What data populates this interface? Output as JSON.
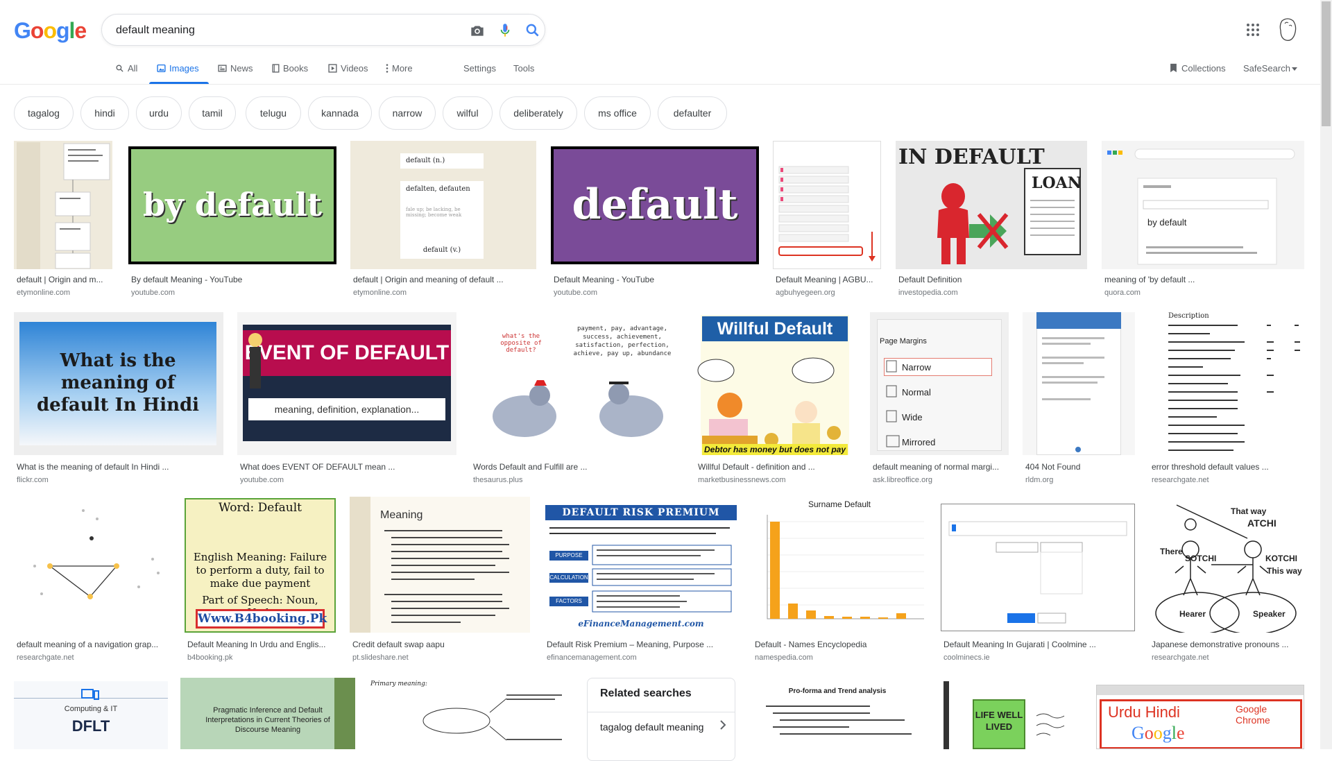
{
  "logo": {
    "letters": [
      "G",
      "o",
      "o",
      "g",
      "l",
      "e"
    ],
    "colors": [
      "#4285f4",
      "#ea4335",
      "#fbbc05",
      "#4285f4",
      "#34a853",
      "#ea4335"
    ]
  },
  "search": {
    "value": "default meaning"
  },
  "tabs": [
    {
      "label": "All",
      "icon": "search-icon"
    },
    {
      "label": "Images",
      "icon": "image-icon"
    },
    {
      "label": "News",
      "icon": "news-icon"
    },
    {
      "label": "Books",
      "icon": "book-icon"
    },
    {
      "label": "Videos",
      "icon": "play-icon"
    },
    {
      "label": "More",
      "icon": "more-vert-icon"
    }
  ],
  "settings_label": "Settings",
  "tools_label": "Tools",
  "collections_label": "Collections",
  "safesearch_label": "SafeSearch",
  "chips": [
    "tagalog",
    "hindi",
    "urdu",
    "tamil",
    "telugu",
    "kannada",
    "narrow",
    "wilful",
    "deliberately",
    "ms office",
    "defaulter"
  ],
  "results": [
    {
      "title": "default | Origin and m...",
      "source": "etymonline.com"
    },
    {
      "title": "By default Meaning - YouTube",
      "source": "youtube.com",
      "thumb_text": "by default"
    },
    {
      "title": "default | Origin and meaning of default ...",
      "source": "etymonline.com",
      "thumb_lines": [
        "default (n.)",
        "defalten, defauten",
        "fale up; be lacking, be missing; become weak",
        "default (v.)"
      ]
    },
    {
      "title": "Default Meaning - YouTube",
      "source": "youtube.com",
      "thumb_text": "default"
    },
    {
      "title": "Default Meaning | AGBU...",
      "source": "agbuhyegeen.org"
    },
    {
      "title": "Default Definition",
      "source": "investopedia.com",
      "thumb_text": "IN DEFAULT",
      "thumb_sub": "LOAN"
    },
    {
      "title": "meaning of 'by default ...",
      "source": "quora.com",
      "thumb_text": "by default"
    },
    {
      "title": "What is the meaning of default In Hindi ...",
      "source": "flickr.com",
      "thumb_text": "What is the meaning of default In Hindi"
    },
    {
      "title": "What does EVENT OF DEFAULT mean ...",
      "source": "youtube.com",
      "thumb_text": "EVENT OF DEFAULT",
      "thumb_sub": "meaning, definition, explanation..."
    },
    {
      "title": "Words Default and Fulfill are ...",
      "source": "thesaurus.plus",
      "thumb_text": "what's the opposite of default?",
      "thumb_sub": "payment, pay, advantage, success, achievement, satisfaction, perfection, achieve, pay up, abundance"
    },
    {
      "title": "Willful Default - definition and ...",
      "source": "marketbusinessnews.com",
      "thumb_text": "Willful Default",
      "thumb_sub": "Debtor has money but does not pay"
    },
    {
      "title": "default meaning of normal margi...",
      "source": "ask.libreoffice.org",
      "thumb_text": "Page Margins",
      "thumb_items": [
        "Narrow",
        "Normal",
        "Wide",
        "Mirrored"
      ]
    },
    {
      "title": "404 Not Found",
      "source": "rldm.org"
    },
    {
      "title": "error threshold default values ...",
      "source": "researchgate.net",
      "thumb_text": "Description"
    },
    {
      "title": "default meaning of a navigation grap...",
      "source": "researchgate.net"
    },
    {
      "title": "Default Meaning In Urdu and Englis...",
      "source": "b4booking.pk",
      "thumb_lines": [
        "Word: Default",
        "English Meaning: Failure to perform a duty, fail to make due payment",
        "Part of Speech: Noun, Verb",
        "Www.B4booking.Pk"
      ]
    },
    {
      "title": "Credit default swap aapu",
      "source": "pt.slideshare.net",
      "thumb_text": "Meaning"
    },
    {
      "title": "Default Risk Premium – Meaning, Purpose ...",
      "source": "efinancemanagement.com",
      "thumb_text": "DEFAULT RISK PREMIUM",
      "thumb_sub": "eFinanceManagement.com",
      "thumb_items": [
        "PURPOSE",
        "CALCULATION",
        "FACTORS"
      ]
    },
    {
      "title": "Default - Names Encyclopedia",
      "source": "namespedia.com",
      "thumb_text": "Surname Default"
    },
    {
      "title": "Default Meaning In Gujarati | Coolmine ...",
      "source": "coolminecs.ie"
    },
    {
      "title": "Japanese demonstrative pronouns ...",
      "source": "researchgate.net",
      "thumb_items": [
        "That way",
        "ATCHI",
        "There",
        "SOTCHI",
        "KOTCHI",
        "This way",
        "Hearer",
        "Speaker"
      ]
    },
    {
      "title": "",
      "source": "",
      "thumb_text": "DFLT",
      "thumb_sub": "Computing & IT"
    },
    {
      "title": "",
      "source": "",
      "thumb_text": "Pragmatic Inference and Default Interpretations in Current Theories of Discourse Meaning"
    },
    {
      "title": "",
      "source": "",
      "thumb_text": "Primary meaning:"
    },
    {
      "title": "",
      "source": "",
      "thumb_text": "Pro-forma and Trend analysis"
    },
    {
      "title": "",
      "source": "",
      "thumb_text": "LIFE WELL LIVED"
    },
    {
      "title": "",
      "source": "",
      "thumb_text": "Urdu Hindi",
      "thumb_sub": "Google Chrome"
    }
  ],
  "related": {
    "heading": "Related searches",
    "item": "tagalog default meaning"
  },
  "colors": {
    "accent": "#1a73e8",
    "text_secondary": "#70757a"
  }
}
